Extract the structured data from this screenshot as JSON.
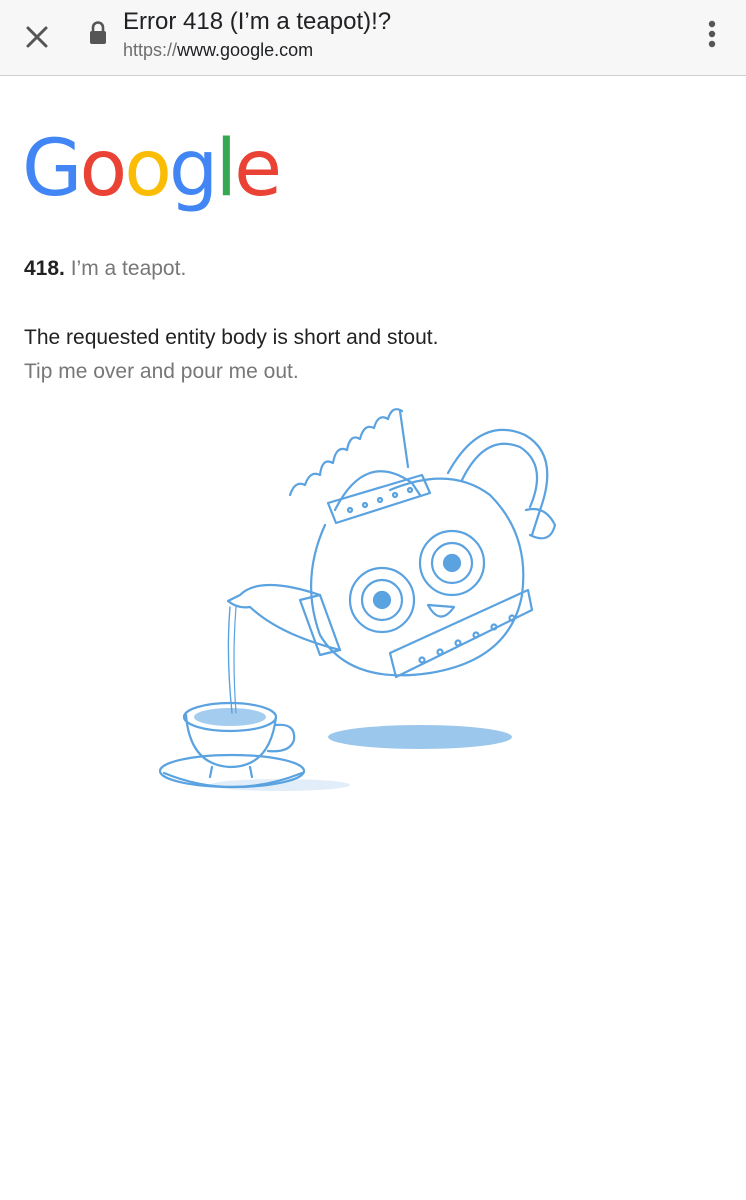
{
  "browser": {
    "title": "Error 418 (I’m a teapot)!?",
    "url_scheme": "https://",
    "url_host": "www.google.com"
  },
  "icons": {
    "close": "close-icon",
    "lock": "lock-icon",
    "menu": "more-vert-icon"
  },
  "logo": {
    "letters": [
      "G",
      "o",
      "o",
      "g",
      "l",
      "e"
    ],
    "colors": [
      "#4285F4",
      "#EA4335",
      "#FBBC05",
      "#4285F4",
      "#34A853",
      "#EA4335"
    ]
  },
  "error": {
    "code": "418.",
    "phrase": "I’m a teapot.",
    "line1": "The requested entity body is short and stout.",
    "line2": "Tip me over and pour me out."
  },
  "colors": {
    "sketch_blue": "#5aa2e0",
    "text_primary": "#222222",
    "text_secondary": "#777777"
  }
}
